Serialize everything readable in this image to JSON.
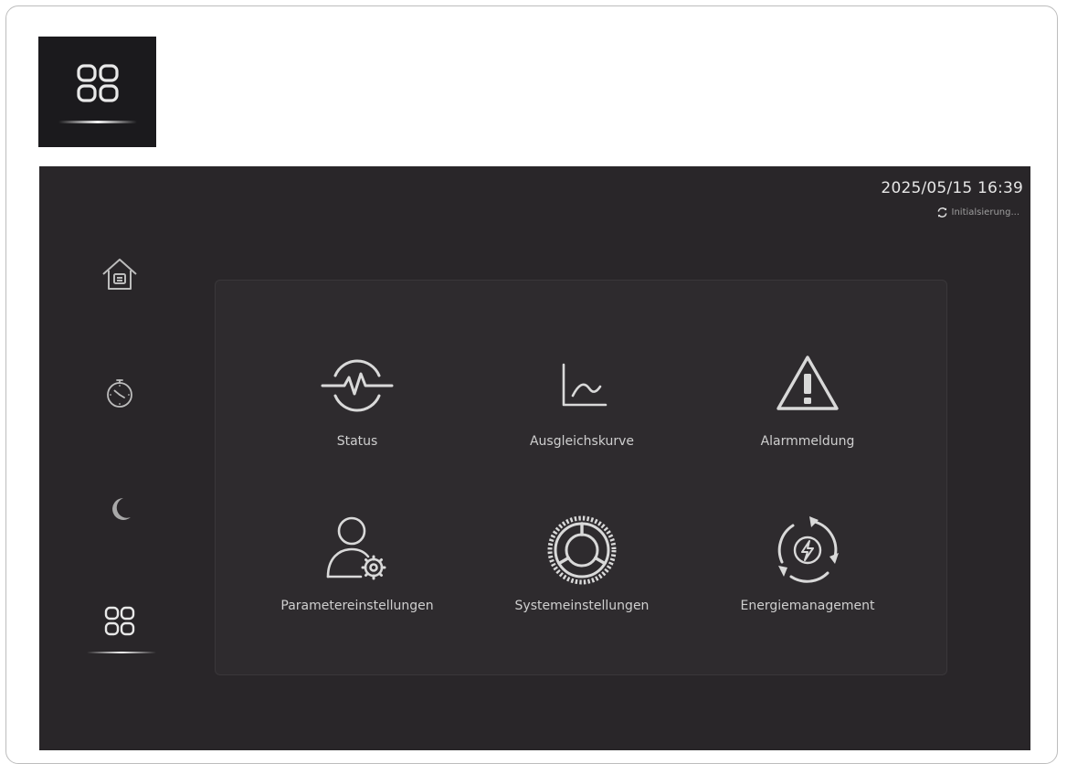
{
  "status_bar": {
    "datetime": "2025/05/15 16:39",
    "sync_status": "Initialsierung..."
  },
  "sidebar": {
    "items": [
      {
        "icon": "home-icon",
        "active": false
      },
      {
        "icon": "timer-icon",
        "active": false
      },
      {
        "icon": "moon-icon",
        "active": false
      },
      {
        "icon": "menu-grid-icon",
        "active": true
      }
    ]
  },
  "menu": {
    "tiles": [
      {
        "label": "Status",
        "icon": "status-pulse-icon"
      },
      {
        "label": "Ausgleichskurve",
        "icon": "curve-chart-icon"
      },
      {
        "label": "Alarmmeldung",
        "icon": "alarm-warning-icon"
      },
      {
        "label": "Parametereinstellungen",
        "icon": "user-settings-icon"
      },
      {
        "label": "Systemeinstellungen",
        "icon": "system-gear-icon"
      },
      {
        "label": "Energiemanagement",
        "icon": "energy-cycle-icon"
      }
    ]
  },
  "colors": {
    "screen_bg": "#292629",
    "panel_bg": "#2e2b2e",
    "icon_stroke": "#d9d9d9",
    "label_text": "#cfcfcf"
  }
}
